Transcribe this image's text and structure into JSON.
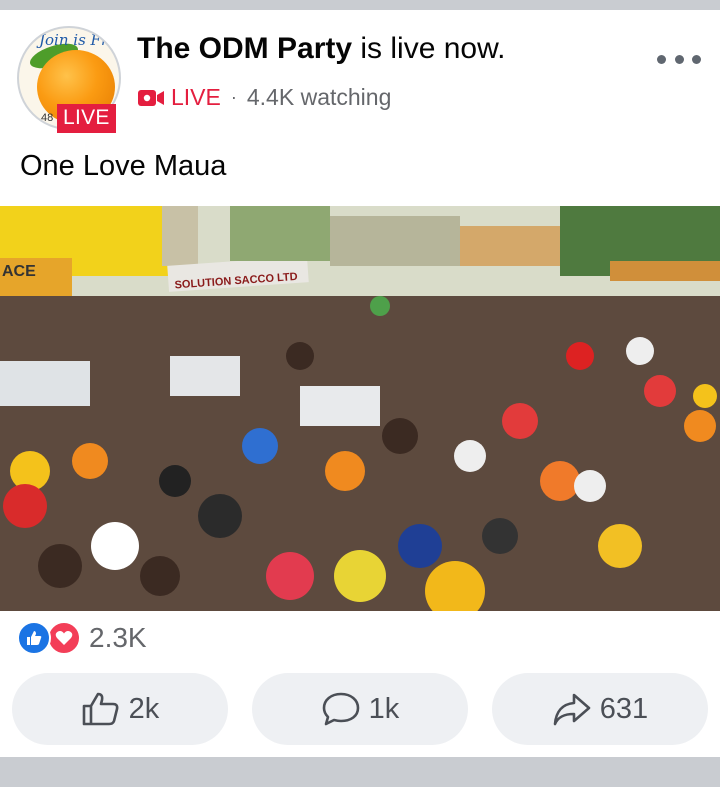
{
  "post": {
    "avatar": {
      "brand_text": "Join is Fr",
      "brand_number": "48",
      "live_badge": "LIVE"
    },
    "page_name": "The ODM Party",
    "status_text": " is live now.",
    "live_label": "LIVE",
    "separator": "·",
    "watching": "4.4K watching",
    "body_text": "One Love Maua",
    "video": {
      "signs": [
        "ACE",
        "SOLUTION SACCO LTD"
      ],
      "sound_icon": "speaker-icon"
    },
    "reactions": {
      "icons": [
        "like-icon",
        "love-icon"
      ],
      "count": "2.3K"
    },
    "actions": {
      "like_count": "2k",
      "comment_count": "1k",
      "share_count": "631"
    }
  },
  "colors": {
    "live_red": "#e41e3f",
    "like_blue": "#1b74e4",
    "love_red": "#f33e58",
    "muted_text": "#65676b",
    "button_bg": "#eef0f3"
  }
}
